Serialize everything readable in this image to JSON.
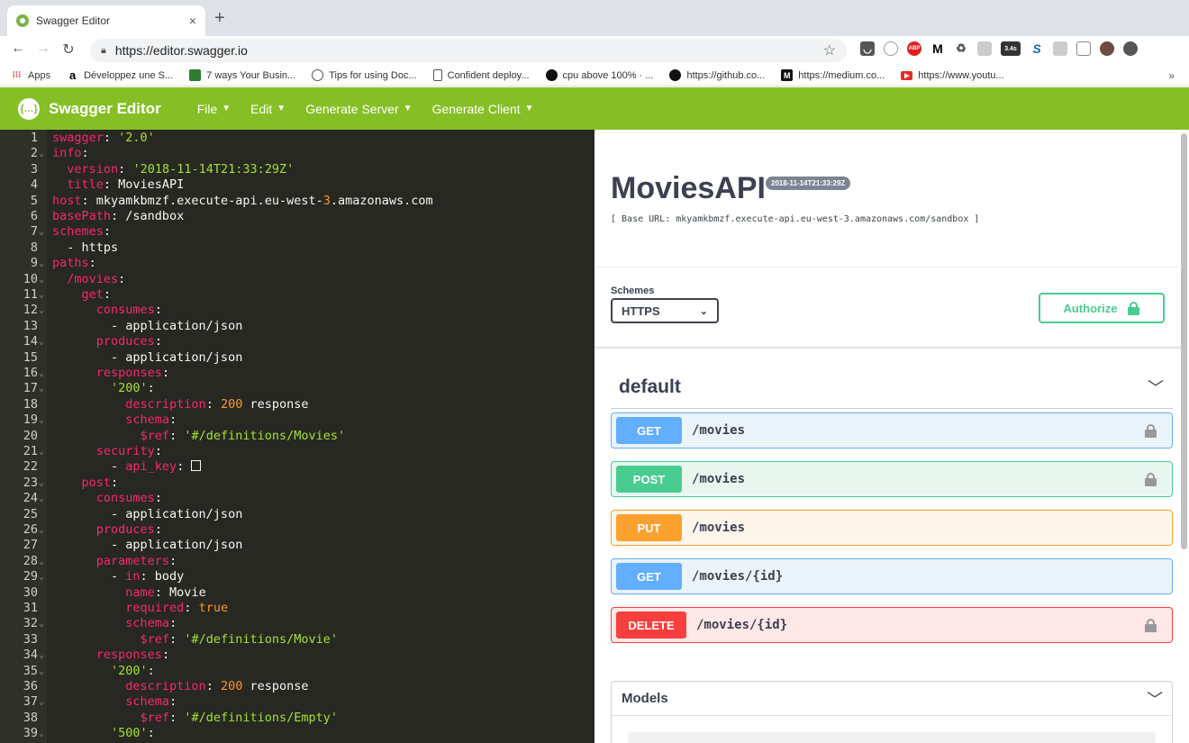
{
  "browser": {
    "tab_title": "Swagger Editor",
    "tab_close": "×",
    "new_tab": "+",
    "url": "https://editor.swagger.io",
    "bookmarks": [
      {
        "label": "Apps",
        "icon": "apps-grid-icon"
      },
      {
        "label": "Développez une S...",
        "icon": "amazon-icon"
      },
      {
        "label": "7 ways Your Busin...",
        "icon": "site-icon"
      },
      {
        "label": "Tips for using Doc...",
        "icon": "docker-icon"
      },
      {
        "label": "Confident deploy...",
        "icon": "page-icon"
      },
      {
        "label": "cpu above 100% · ...",
        "icon": "github-icon"
      },
      {
        "label": "https://github.co...",
        "icon": "github-icon"
      },
      {
        "label": "https://medium.co...",
        "icon": "medium-icon"
      },
      {
        "label": "https://www.youtu...",
        "icon": "youtube-icon"
      }
    ],
    "bookmarks_more": "»",
    "extension_badge": "3.4s"
  },
  "app": {
    "name": "Swagger Editor",
    "menu": [
      "File",
      "Edit",
      "Generate Server",
      "Generate Client"
    ],
    "brand_color": "#85bf25"
  },
  "editor": {
    "lines": [
      {
        "n": "1",
        "fold": false,
        "html": "<span class='k'>swagger</span>: <span class='s'>'2.0'</span>"
      },
      {
        "n": "2",
        "fold": true,
        "html": "<span class='k'>info</span>:"
      },
      {
        "n": "3",
        "fold": false,
        "html": "  <span class='k'>version</span>: <span class='s'>'2018-11-14T21:33:29Z'</span>"
      },
      {
        "n": "4",
        "fold": false,
        "html": "  <span class='k'>title</span>: MoviesAPI"
      },
      {
        "n": "5",
        "fold": false,
        "html": "<span class='k'>host</span>: mkyamkbmzf.execute-api.eu-west-<span class='n'>3</span>.amazonaws.com"
      },
      {
        "n": "6",
        "fold": false,
        "html": "<span class='k'>basePath</span>: /sandbox"
      },
      {
        "n": "7",
        "fold": true,
        "html": "<span class='k'>schemes</span>:"
      },
      {
        "n": "8",
        "fold": false,
        "html": "  - https"
      },
      {
        "n": "9",
        "fold": true,
        "html": "<span class='k'>paths</span>:"
      },
      {
        "n": "10",
        "fold": true,
        "html": "  <span class='k'>/movies</span>:"
      },
      {
        "n": "11",
        "fold": true,
        "html": "    <span class='k'>get</span>:"
      },
      {
        "n": "12",
        "fold": true,
        "html": "      <span class='k'>consumes</span>:"
      },
      {
        "n": "13",
        "fold": false,
        "html": "        - application/json"
      },
      {
        "n": "14",
        "fold": true,
        "html": "      <span class='k'>produces</span>:"
      },
      {
        "n": "15",
        "fold": false,
        "html": "        - application/json"
      },
      {
        "n": "16",
        "fold": true,
        "html": "      <span class='k'>responses</span>:"
      },
      {
        "n": "17",
        "fold": true,
        "html": "        <span class='s'>'200'</span>:"
      },
      {
        "n": "18",
        "fold": false,
        "html": "          <span class='k'>description</span>: <span class='n'>200</span> response"
      },
      {
        "n": "19",
        "fold": true,
        "html": "          <span class='k'>schema</span>:"
      },
      {
        "n": "20",
        "fold": false,
        "html": "            <span class='k'>$ref</span>: <span class='s'>'#/definitions/Movies'</span>"
      },
      {
        "n": "21",
        "fold": true,
        "html": "      <span class='k'>security</span>:"
      },
      {
        "n": "22",
        "fold": false,
        "html": "        - <span class='k'>api_key</span>: <span class='box'></span>"
      },
      {
        "n": "23",
        "fold": true,
        "html": "    <span class='k'>post</span>:"
      },
      {
        "n": "24",
        "fold": true,
        "html": "      <span class='k'>consumes</span>:"
      },
      {
        "n": "25",
        "fold": false,
        "html": "        - application/json"
      },
      {
        "n": "26",
        "fold": true,
        "html": "      <span class='k'>produces</span>:"
      },
      {
        "n": "27",
        "fold": false,
        "html": "        - application/json"
      },
      {
        "n": "28",
        "fold": true,
        "html": "      <span class='k'>parameters</span>:"
      },
      {
        "n": "29",
        "fold": true,
        "html": "        - <span class='k'>in</span>: body"
      },
      {
        "n": "30",
        "fold": false,
        "html": "          <span class='k'>name</span>: Movie"
      },
      {
        "n": "31",
        "fold": false,
        "html": "          <span class='k'>required</span>: <span class='n'>true</span>"
      },
      {
        "n": "32",
        "fold": true,
        "html": "          <span class='k'>schema</span>:"
      },
      {
        "n": "33",
        "fold": false,
        "html": "            <span class='k'>$ref</span>: <span class='s'>'#/definitions/Movie'</span>"
      },
      {
        "n": "34",
        "fold": true,
        "html": "      <span class='k'>responses</span>:"
      },
      {
        "n": "35",
        "fold": true,
        "html": "        <span class='s'>'200'</span>:"
      },
      {
        "n": "36",
        "fold": false,
        "html": "          <span class='k'>description</span>: <span class='n'>200</span> response"
      },
      {
        "n": "37",
        "fold": true,
        "html": "          <span class='k'>schema</span>:"
      },
      {
        "n": "38",
        "fold": false,
        "html": "            <span class='k'>$ref</span>: <span class='s'>'#/definitions/Empty'</span>"
      },
      {
        "n": "39",
        "fold": true,
        "html": "        <span class='s'>'500'</span>:"
      }
    ]
  },
  "preview": {
    "title": "MoviesAPI",
    "version": "2018-11-14T21:33:29Z",
    "base_url": "[ Base URL: mkyamkbmzf.execute-api.eu-west-3.amazonaws.com/sandbox ]",
    "schemes_label": "Schemes",
    "schemes_value": "HTTPS",
    "authorize_label": "Authorize",
    "section_title": "default",
    "operations": [
      {
        "method": "GET",
        "path": "/movies",
        "locked": true,
        "color": "#61affe",
        "bg": "#ebf3fb"
      },
      {
        "method": "POST",
        "path": "/movies",
        "locked": true,
        "color": "#49cc90",
        "bg": "#e8f6f0"
      },
      {
        "method": "PUT",
        "path": "/movies",
        "locked": false,
        "color": "#fca130",
        "bg": "#fff5ea"
      },
      {
        "method": "GET",
        "path": "/movies/{id}",
        "locked": false,
        "color": "#61affe",
        "bg": "#ebf3fb"
      },
      {
        "method": "DELETE",
        "path": "/movies/{id}",
        "locked": true,
        "color": "#f93e3e",
        "bg": "#fde7e7"
      }
    ],
    "models_title": "Models"
  }
}
